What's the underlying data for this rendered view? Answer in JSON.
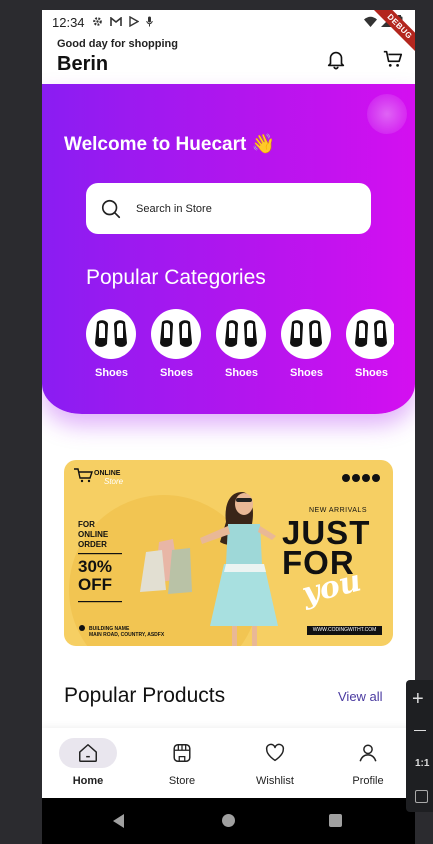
{
  "status_bar": {
    "time": "12:34",
    "debug_label": "DEBUG"
  },
  "header": {
    "greeting": "Good day for shopping",
    "user_name": "Berin"
  },
  "hero": {
    "welcome": "Welcome to Huecart 👋",
    "search_placeholder": "Search in Store",
    "categories_title": "Popular Categories",
    "categories": [
      {
        "label": "Shoes",
        "icon": "shoes-icon"
      },
      {
        "label": "Shoes",
        "icon": "shoes-icon"
      },
      {
        "label": "Shoes",
        "icon": "shoes-icon"
      },
      {
        "label": "Shoes",
        "icon": "shoes-icon"
      },
      {
        "label": "Shoes",
        "icon": "shoes-icon"
      }
    ]
  },
  "banner": {
    "brand_line1": "ONLINE",
    "brand_line2": "Store",
    "for_line1": "FOR",
    "for_line2": "ONLINE",
    "for_line3": "ORDER",
    "off_line1": "30%",
    "off_line2": "OFF",
    "new_arrivals": "NEW ARRIVALS",
    "just": "JUST",
    "for_word": "FOR",
    "you": "you",
    "address_line1": "BUILDING NAME",
    "address_line2": "MAIN ROAD, COUNTRY, ASDFX",
    "website": "WWW.CODINGWITHT.COM"
  },
  "products": {
    "title": "Popular Products",
    "view_all": "View all"
  },
  "nav": {
    "items": [
      {
        "label": "Home",
        "icon": "home-icon",
        "active": true
      },
      {
        "label": "Store",
        "icon": "store-icon",
        "active": false
      },
      {
        "label": "Wishlist",
        "icon": "heart-icon",
        "active": false
      },
      {
        "label": "Profile",
        "icon": "profile-icon",
        "active": false
      }
    ]
  },
  "emulator_tools": {
    "ratio": "1:1"
  },
  "colors": {
    "hero_start": "#8a1df2",
    "hero_end": "#d40ff0",
    "banner_bg": "#f6cf63",
    "accent_link": "#4a3aa0"
  }
}
